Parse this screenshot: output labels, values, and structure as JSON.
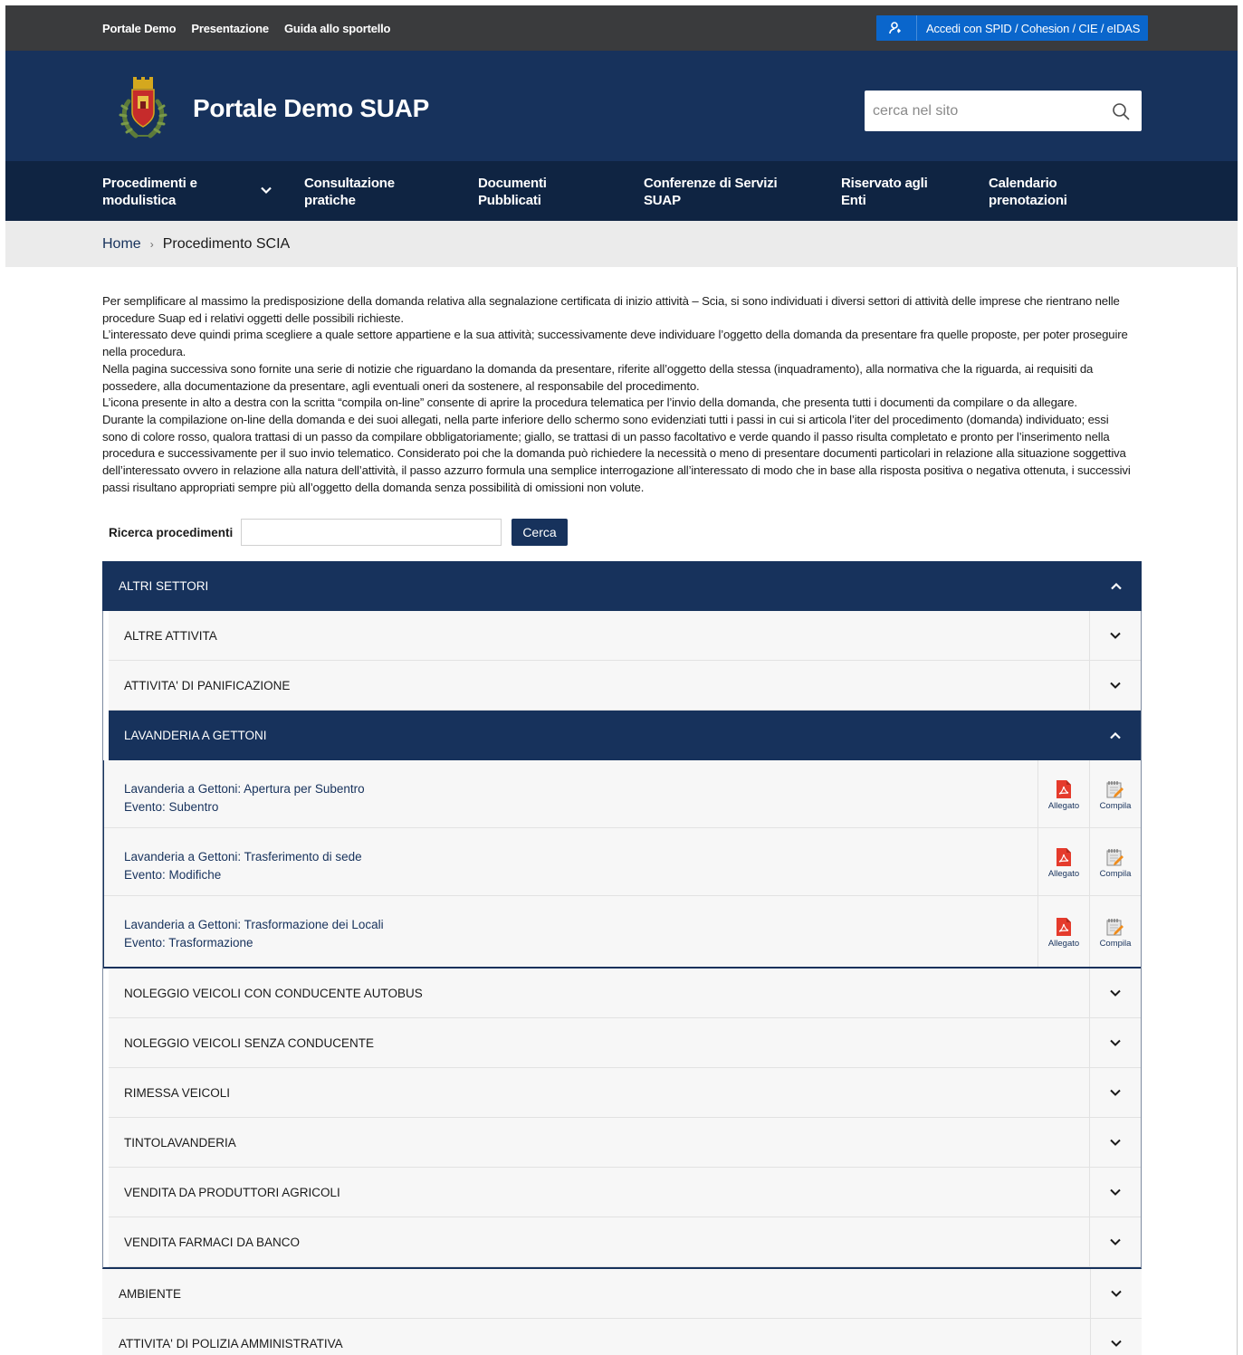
{
  "topbar": {
    "links": [
      "Portale Demo",
      "Presentazione",
      "Guida allo sportello"
    ],
    "login_label": "Accedi con SPID / Cohesion / CIE / eIDAS"
  },
  "header": {
    "title": "Portale Demo SUAP",
    "search_placeholder": "cerca nel sito"
  },
  "nav": {
    "items": [
      {
        "line1": "Procedimenti e",
        "line2": "modulistica"
      },
      {
        "line1": "Consultazione",
        "line2": "pratiche"
      },
      {
        "line1": "Documenti",
        "line2": "Pubblicati"
      },
      {
        "line1": "Conferenze di Servizi",
        "line2": "SUAP"
      },
      {
        "line1": "Riservato agli",
        "line2": "Enti"
      },
      {
        "line1": "Calendario",
        "line2": "prenotazioni"
      }
    ]
  },
  "breadcrumb": {
    "home": "Home",
    "separator": "›",
    "current": "Procedimento SCIA"
  },
  "intro": {
    "paragraphs": [
      "Per semplificare al massimo la predisposizione della domanda relativa alla segnalazione certificata di inizio attività – Scia, si sono individuati i diversi settori di attività delle imprese che rientrano nelle procedure Suap ed i relativi oggetti delle possibili richieste.",
      "L’interessato deve quindi prima scegliere a quale settore appartiene e la sua attività; successivamente deve individuare l’oggetto della domanda da presentare fra quelle proposte, per poter proseguire nella procedura.",
      "Nella pagina successiva sono fornite una serie di notizie che riguardano la domanda da presentare, riferite all’oggetto della stessa (inquadramento), alla normativa che la riguarda, ai requisiti da possedere, alla documentazione da presentare, agli eventuali oneri da sostenere, al responsabile del procedimento.",
      "L’icona presente in alto a destra con la scritta “compila on-line” consente di aprire la procedura telematica per l’invio della domanda, che presenta tutti i documenti da compilare o da allegare.",
      "Durante la compilazione on-line della domanda e dei suoi allegati, nella parte inferiore dello schermo sono evidenziati tutti i passi in cui si articola l’iter del procedimento (domanda) individuato; essi sono di colore rosso, qualora trattasi di un passo da compilare obbligatoriamente; giallo, se trattasi di un passo facoltativo e verde quando il passo risulta completato e pronto per l’inserimento nella procedura e successivamente per il suo invio telematico. Considerato poi che la domanda può richiedere la necessità o meno di presentare documenti particolari in relazione alla situazione soggettiva dell’interessato ovvero in relazione alla natura dell’attività, il passo azzurro formula una semplice interrogazione all’interessato di modo che in base alla risposta positiva o negativa ottenuta, i successivi passi risultano appropriati sempre più all’oggetto della domanda senza possibilità di omissioni non volute."
    ]
  },
  "search_proc": {
    "label": "Ricerca procedimenti",
    "value": "",
    "button": "Cerca"
  },
  "accordion": {
    "open_sector": "ALTRI SETTORI",
    "activities_before": [
      "ALTRE ATTIVITA",
      "ATTIVITA' DI PANIFICAZIONE"
    ],
    "open_activity": "LAVANDERIA A GETTONI",
    "procedures": [
      {
        "title": "Lavanderia a Gettoni: Apertura per Subentro",
        "event": "Evento: Subentro"
      },
      {
        "title": "Lavanderia a Gettoni: Trasferimento di sede",
        "event": "Evento: Modifiche"
      },
      {
        "title": "Lavanderia a Gettoni: Trasformazione dei Locali",
        "event": "Evento: Trasformazione"
      }
    ],
    "action_labels": {
      "attachment": "Allegato",
      "fill": "Compila"
    },
    "activities_after": [
      "NOLEGGIO VEICOLI CON CONDUCENTE AUTOBUS",
      "NOLEGGIO VEICOLI SENZA CONDUCENTE",
      "RIMESSA VEICOLI",
      "TINTOLAVANDERIA",
      "VENDITA DA PRODUTTORI AGRICOLI",
      "VENDITA FARMACI DA BANCO"
    ],
    "other_sectors": [
      "AMBIENTE",
      "ATTIVITA' DI POLIZIA AMMINISTRATIVA"
    ]
  },
  "colors": {
    "topbar": "#3a3b3d",
    "header": "#17325c",
    "nav": "#0f2442",
    "spid_button": "#0a66cc",
    "attachment_icon": "#e53b2c"
  }
}
